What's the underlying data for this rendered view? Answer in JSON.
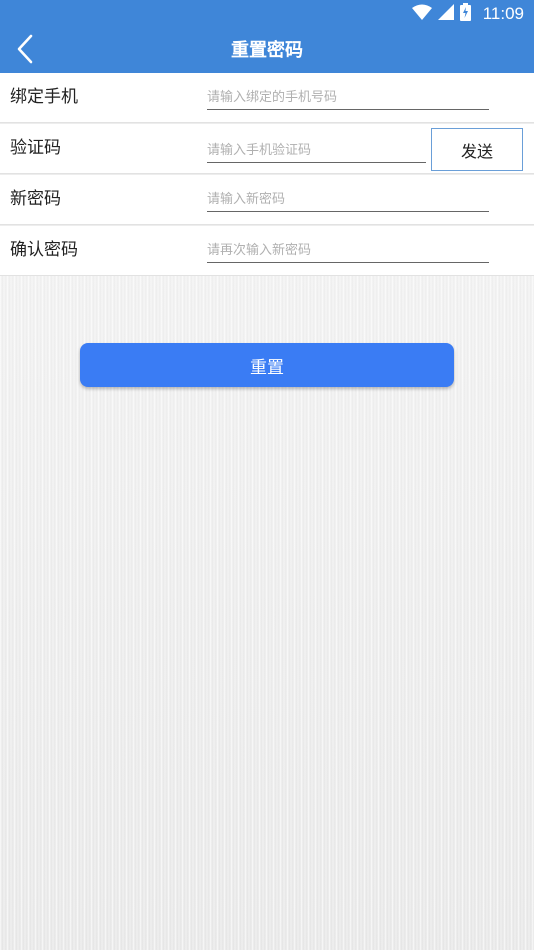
{
  "status_bar": {
    "time": "11:09",
    "icons": [
      "wifi-icon",
      "cellular-signal-icon",
      "battery-charging-icon"
    ]
  },
  "header": {
    "title": "重置密码",
    "back_icon": "chevron-left-icon"
  },
  "form": {
    "phone": {
      "label": "绑定手机",
      "placeholder": "请输入绑定的手机号码",
      "value": ""
    },
    "code": {
      "label": "验证码",
      "placeholder": "请输入手机验证码",
      "value": "",
      "send_label": "发送"
    },
    "new_password": {
      "label": "新密码",
      "placeholder": "请输入新密码",
      "value": ""
    },
    "confirm_password": {
      "label": "确认密码",
      "placeholder": "请再次输入新密码",
      "value": ""
    }
  },
  "actions": {
    "reset_label": "重置"
  },
  "colors": {
    "primary": "#3f86d8",
    "button": "#3a7cf4",
    "background": "#ededed"
  }
}
